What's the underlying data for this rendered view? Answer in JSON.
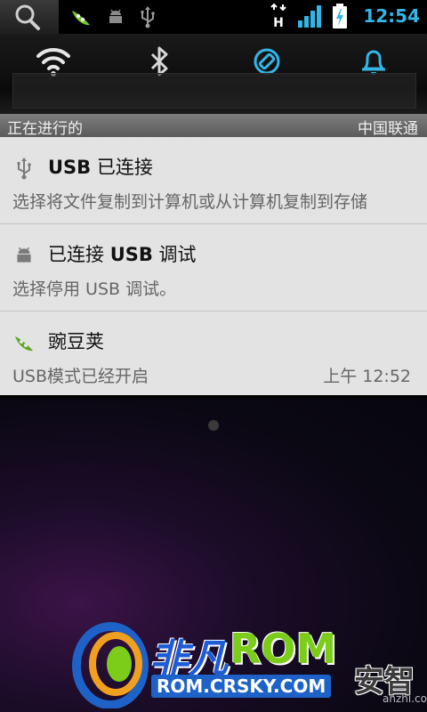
{
  "status_bar": {
    "clock": "12:54",
    "data_type": "H",
    "accent": "#33b5e5",
    "left_icons": [
      "wandoujia-pea-icon",
      "android-debug-icon",
      "usb-icon"
    ],
    "right_icons": [
      "data-transfer-icon",
      "signal-icon",
      "battery-charging-icon"
    ]
  },
  "quick_toggles": [
    {
      "name": "wifi-toggle",
      "icon": "wifi-icon",
      "active": false
    },
    {
      "name": "bluetooth-toggle",
      "icon": "bluetooth-icon",
      "active": false
    },
    {
      "name": "auto-rotate-toggle",
      "icon": "rotate-icon",
      "active": true
    },
    {
      "name": "sound-toggle",
      "icon": "bell-icon",
      "active": true
    }
  ],
  "ongoing": {
    "label": "正在进行的",
    "carrier": "中国联通"
  },
  "notifications": [
    {
      "title_bold": "USB",
      "title_rest": " 已连接",
      "body": "选择将文件复制到计算机或从计算机复制到存储",
      "time": "",
      "icon": "usb-icon"
    },
    {
      "title_rest_pre": "已连接 ",
      "title_bold": "USB",
      "title_rest": " 调试",
      "body": "选择停用 USB 调试。",
      "time": "",
      "icon": "android-debug-icon"
    },
    {
      "title_rest": "豌豆荚",
      "body": "USB模式已经开启",
      "time": "上午 12:52",
      "icon": "wandoujia-pea-icon"
    }
  ],
  "watermark": {
    "brand_part1": "非凡",
    "brand_part2": "ROM",
    "url": "ROM.CRSKY.COM",
    "anzhi": "安智",
    "anzhi_url": "anzhi.com"
  }
}
